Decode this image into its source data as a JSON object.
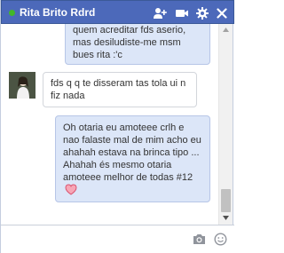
{
  "chat": {
    "contact_name": "Rita Brito Rdrd",
    "online": true
  },
  "header_icons": [
    "add-friend-icon",
    "video-call-icon",
    "gear-icon",
    "close-icon"
  ],
  "messages": [
    {
      "from": "me",
      "text": "quem acreditar fds aserio, mas desiludiste-me msm bues rita :'c"
    },
    {
      "from": "them",
      "text": "fds q q te disseram tas tola ui n fiz nada"
    },
    {
      "from": "me",
      "text": "Oh otaria eu amoteee crlh e nao falaste mal de mim acho eu ahahah estava  na brinca tipo ... Ahahah és mesmo otaria amoteee melhor de todas #12",
      "emoji": "heart-emoji"
    }
  ],
  "composer": {
    "placeholder": "",
    "value": ""
  },
  "colors": {
    "header_bg": "#4c69ba",
    "my_bubble": "#dce6f8",
    "their_bubble": "#ffffff",
    "online_dot": "#42b72a"
  }
}
